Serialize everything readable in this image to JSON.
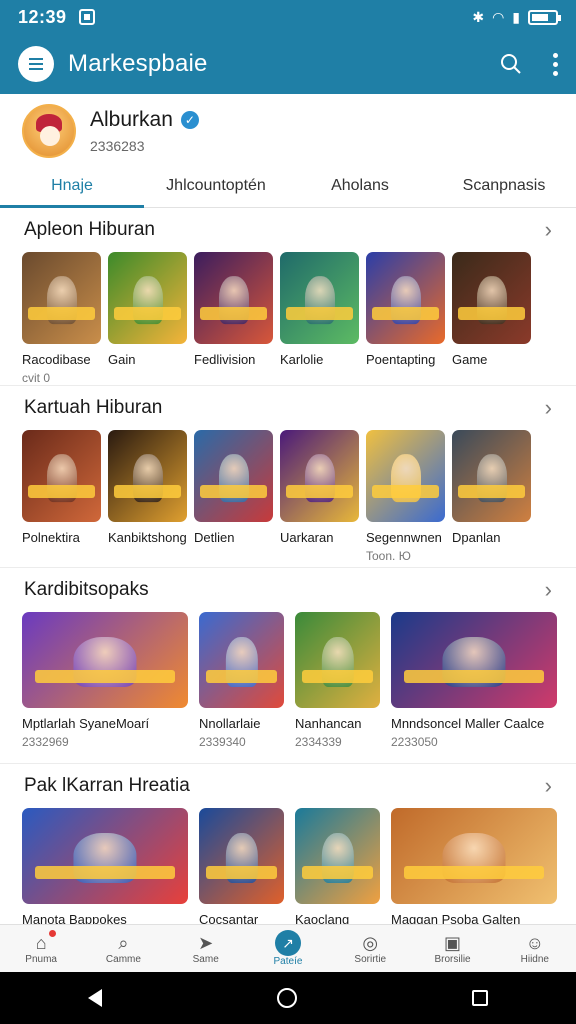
{
  "status": {
    "time": "12:39"
  },
  "appbar": {
    "title": "Markespbaie"
  },
  "profile": {
    "name": "Alburkan",
    "id": "2336283"
  },
  "tabs": [
    {
      "label": "Hnaje",
      "active": true
    },
    {
      "label": "Jhlcountoptén",
      "active": false
    },
    {
      "label": "Aholans",
      "active": false
    },
    {
      "label": "Scanpnasis",
      "active": false
    }
  ],
  "sections": [
    {
      "title": "Apleon Hiburan",
      "items": [
        {
          "label": "Racodibase",
          "sub": "cvit 0",
          "colors": [
            "#6a4a2e",
            "#c98e4a"
          ]
        },
        {
          "label": "Gain",
          "sub": "",
          "colors": [
            "#3c8a2a",
            "#f5b43a"
          ]
        },
        {
          "label": "Fedlivision",
          "sub": "",
          "colors": [
            "#3b1d5e",
            "#d8573a"
          ]
        },
        {
          "label": "Karlolie",
          "sub": "",
          "colors": [
            "#1f6a6a",
            "#5dbb63"
          ]
        },
        {
          "label": "Poentapting",
          "sub": "",
          "colors": [
            "#2b3ea8",
            "#e96a2a"
          ]
        },
        {
          "label": "Game",
          "sub": "",
          "colors": [
            "#3a2a1a",
            "#8b3a2a"
          ]
        }
      ]
    },
    {
      "title": "Kartuah Hiburan",
      "items": [
        {
          "label": "Polnektira",
          "sub": "",
          "colors": [
            "#6a2a1a",
            "#d0683a"
          ]
        },
        {
          "label": "Kanbiktshong",
          "sub": "",
          "colors": [
            "#2a1a10",
            "#e0a030"
          ]
        },
        {
          "label": "Detlien",
          "sub": "",
          "colors": [
            "#2a6aa8",
            "#c83a3a"
          ]
        },
        {
          "label": "Uarkaran",
          "sub": "",
          "colors": [
            "#4a1a7a",
            "#e8b83a"
          ]
        },
        {
          "label": "Segennwnen",
          "sub": "Toon. Ю",
          "colors": [
            "#f0c040",
            "#3a6ad0"
          ]
        },
        {
          "label": "Dpanlan",
          "sub": "",
          "colors": [
            "#3a4a5a",
            "#d08040"
          ]
        }
      ]
    },
    {
      "title": "Kardibitsopaks",
      "items": [
        {
          "label": "Mptlarlah SyaneMoarí",
          "sub": "2332969",
          "colors": [
            "#6a3ac0",
            "#f08a30"
          ],
          "size": "wide"
        },
        {
          "label": "Nnollarlaie",
          "sub": "2339340",
          "colors": [
            "#3a6ad0",
            "#e04a3a"
          ]
        },
        {
          "label": "Nanhancan",
          "sub": "2334339",
          "colors": [
            "#3a8a3a",
            "#e0b040"
          ]
        },
        {
          "label": "Mnndsoncel Maller Caalce",
          "sub": "2233050",
          "colors": [
            "#1a3a8a",
            "#d03a6a"
          ],
          "size": "wide"
        }
      ]
    },
    {
      "title": "Pak lKarran Hreatia",
      "items": [
        {
          "label": "Manota Bappokes",
          "sub": "",
          "colors": [
            "#2a5ac0",
            "#e8403a"
          ],
          "size": "wide"
        },
        {
          "label": "Cocsantar",
          "sub": "",
          "colors": [
            "#1a4a9a",
            "#e0602a"
          ]
        },
        {
          "label": "Kaoclang",
          "sub": "",
          "colors": [
            "#1a7a9a",
            "#f0a040"
          ]
        },
        {
          "label": "Maggan Psoba Galten",
          "sub": "",
          "colors": [
            "#c06a2a",
            "#f0c070"
          ],
          "size": "wide"
        }
      ]
    }
  ],
  "bottomnav": [
    {
      "label": "Pnuma",
      "icon": "home-icon",
      "active": false
    },
    {
      "label": "Camme",
      "icon": "search-icon",
      "active": false
    },
    {
      "label": "Same",
      "icon": "send-icon",
      "active": false
    },
    {
      "label": "Pateíe",
      "icon": "arrow-icon",
      "active": true
    },
    {
      "label": "Sorirtie",
      "icon": "camera-icon",
      "active": false
    },
    {
      "label": "Brorsilie",
      "icon": "clipboard-icon",
      "active": false
    },
    {
      "label": "Hiidne",
      "icon": "profile-icon",
      "active": false
    }
  ]
}
